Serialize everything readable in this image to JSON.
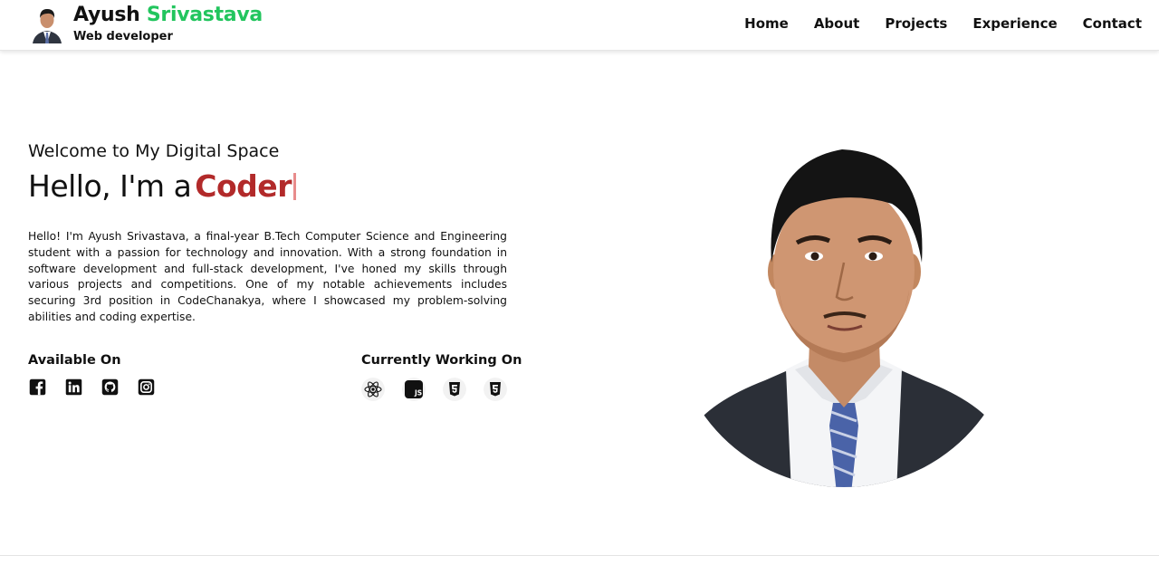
{
  "header": {
    "name_first": "Ayush",
    "name_last": "Srivastava",
    "subtitle": "Web developer",
    "nav": [
      {
        "label": "Home"
      },
      {
        "label": "About"
      },
      {
        "label": "Projects"
      },
      {
        "label": "Experience"
      },
      {
        "label": "Contact"
      }
    ]
  },
  "hero": {
    "welcome": "Welcome to My Digital Space",
    "greeting": "Hello, I'm a",
    "role": "Coder",
    "bio": "Hello! I'm Ayush Srivastava, a final-year B.Tech Computer Science and Engineering student with a passion for technology and innovation. With a strong foundation in software development and full-stack development, I've honed my skills through various projects and competitions. One of my notable achievements includes securing 3rd position in CodeChanakya, where I showcased my problem-solving abilities and coding expertise."
  },
  "available": {
    "title": "Available On",
    "icons": [
      "facebook-icon",
      "linkedin-icon",
      "github-icon",
      "instagram-icon"
    ]
  },
  "working": {
    "title": "Currently Working On",
    "icons": [
      "react-icon",
      "javascript-icon",
      "html5-icon",
      "css3-icon"
    ]
  },
  "colors": {
    "accent_green": "#22c55e",
    "accent_red": "#b22a2a",
    "text": "#111111"
  }
}
